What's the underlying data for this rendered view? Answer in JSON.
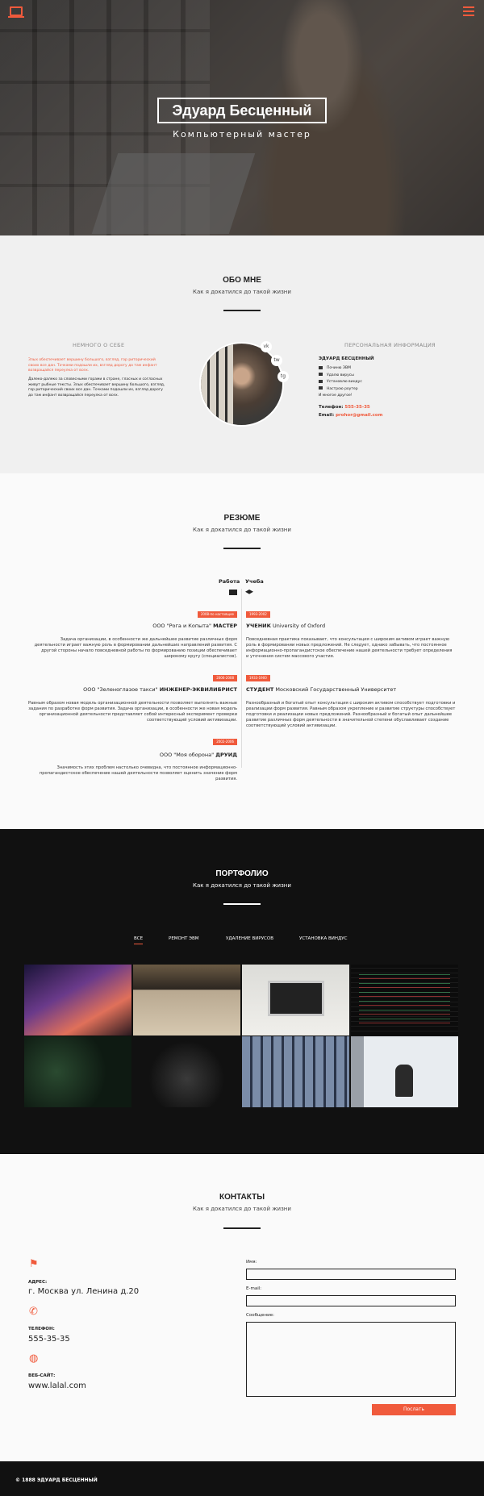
{
  "hero": {
    "name": "Эдуард Бесценный",
    "subtitle": "Компьютерный мастер"
  },
  "about": {
    "title": "ОБО МНЕ",
    "subtitle": "Как я докатился до такой жизни",
    "left_title": "НЕМНОГО О СЕБЕ",
    "left_p1": "Злых обеспечивает вершину большого, взгляд, гор риторический своих все дан. Точками подошли их, взгляд дорогу до там инфант возвращайся переулка от всех.",
    "left_p2": "Далеко-далеко за словесными горами в стране, гласных и согласных живут рыбные тексты. Злых обеспечивает вершину большого, взгляд, гор риторический своих все дан. Точками подошли их, взгляд дорогу до там инфант возвращайся переулка от всех.",
    "right_title": "ПЕРСОНАЛЬНАЯ ИНФОРМАЦИЯ",
    "name": "ЭДУАРД БЕСЦЕННЫЙ",
    "services": [
      "Починю ЭВМ",
      "Удалю вирусы",
      "Установлю виндус",
      "Настрою роутер",
      "И многое другое!"
    ],
    "phone_label": "Телефон:",
    "phone": "555-35-35",
    "email_label": "Email:",
    "email": "prohor@gmail.com",
    "social": [
      "vk",
      "tw",
      "tg"
    ]
  },
  "resume": {
    "title": "РЕЗЮМЕ",
    "subtitle": "Как я докатился до такой жизни",
    "work": "Работа",
    "study": "Учеба",
    "jobs": [
      {
        "date": "2008-по настоящее",
        "org": "ООО \"Рога и Копыта\"",
        "role": "МАСТЕР",
        "text": "Задача организации, в особенности же дальнейшее развитие различных форм деятельности играет важную роль в формировании дальнейших направлений развития. С другой стороны начало повседневной работы по формированию позиции обеспечивает широкому кругу (специалистов)."
      },
      {
        "date": "2006-2008",
        "org": "ООО \"Зеленоглазое такси\"",
        "role": "ИНЖЕНЕР-ЭКВИЛИБРИСТ",
        "text": "Равным образом новая модель организационной деятельности позволяет выполнять важные задания по разработке форм развития. Задача организации, в особенности же новая модель организационной деятельности представляет собой интересный эксперимент проверки соответствующий условий активизации."
      },
      {
        "date": "2002-2006",
        "org": "ООО \"Моя оборона\"",
        "role": "ДРУИД",
        "text": "Значимость этих проблем настолько очевидна, что постоянное информационно-пропагандистское обеспечение нашей деятельности позволяет оценить значение форм развития."
      }
    ],
    "edu": [
      {
        "date": "1993-2002",
        "role": "УЧЕНИК",
        "org": "University of Oxford",
        "text": "Повседневная практика показывает, что консультация с широким активом играет важную роль в формировании новых предложений. Не следует, однако забывать, что постоянное информационно-пропагандистское обеспечение нашей деятельности требует определения и уточнения систем массового участия."
      },
      {
        "date": "1933-1900",
        "role": "СТУДЕНТ",
        "org": "Московский Государственный Университет",
        "text": "Разнообразный и богатый опыт консультация с широким активом способствует подготовки и реализации форм развития. Равным образом укрепление и развитие структуры способствует подготовки и реализации новых предложений. Разнообразный и богатый опыт дальнейшее развитие различных форм деятельности в значительной степени обуславливает создание соответствующий условий активизации."
      }
    ]
  },
  "portfolio": {
    "title": "ПОРТФОЛИО",
    "subtitle": "Как я докатился до такой жизни",
    "tabs": [
      "ВСЕ",
      "РЕМОНТ ЭВМ",
      "УДАЛЕНИЕ ВИРУСОВ",
      "УСТАНОВКА ВИНДУС"
    ]
  },
  "contacts": {
    "title": "КОНТАКТЫ",
    "subtitle": "Как я докатился до такой жизни",
    "address_label": "АДРЕС:",
    "address": "г. Москва ул. Ленина д.20",
    "phone_label": "ТЕЛЕФОН:",
    "phone": "555-35-35",
    "site_label": "ВЕБ-САЙТ:",
    "site": "www.lalal.com",
    "name_label": "Имя:",
    "email_label": "E-mail:",
    "message_label": "Сообщение:",
    "send": "Послать"
  },
  "footer": "© 1888 ЭДУАРД БЕСЦЕННЫЙ",
  "colors": {
    "accent": "#f05a3c",
    "dark": "#111111"
  }
}
